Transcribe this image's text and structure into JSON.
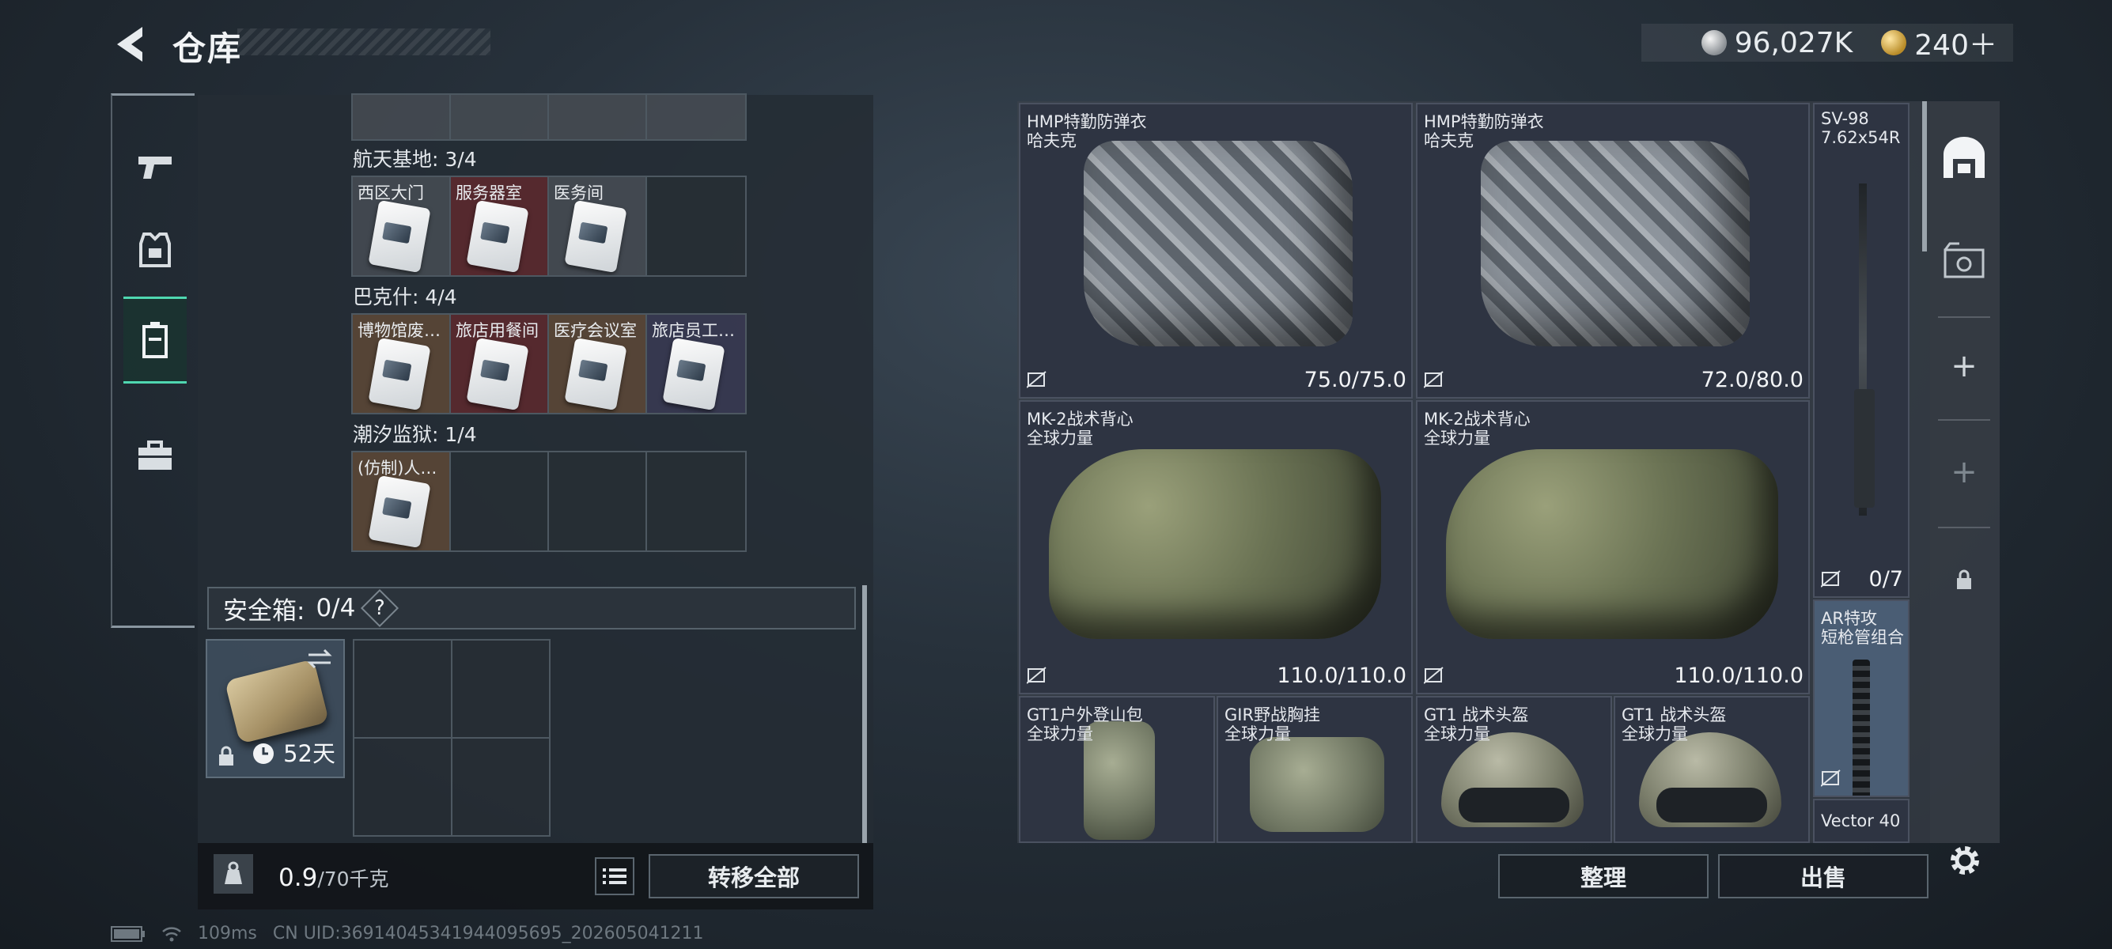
{
  "header": {
    "title": "仓库",
    "back_icon": "back-arrow-icon"
  },
  "currency": {
    "silver_amount": "96,027K",
    "gold_amount": "240＋"
  },
  "left_tabs": [
    {
      "icon": "pistol-icon"
    },
    {
      "icon": "armor-icon"
    },
    {
      "icon": "keycard-case-icon",
      "active": true
    },
    {
      "icon": "briefcase-icon"
    }
  ],
  "key_regions": [
    {
      "label": "航天基地: 3/4",
      "cells": [
        "西区大门",
        "服务器室",
        "医务间",
        ""
      ]
    },
    {
      "label": "巴克什: 4/4",
      "cells": [
        "博物馆废…",
        "旅店用餐间",
        "医疗会议室",
        "旅店员工…"
      ]
    },
    {
      "label": "潮汐监狱: 1/4",
      "cells": [
        "(仿制)人…",
        "",
        "",
        ""
      ]
    }
  ],
  "safe_box": {
    "label": "安全箱:",
    "count": "0/4",
    "help": "?",
    "days": "52天"
  },
  "capacity": {
    "current": "0.9",
    "max": "/70千克",
    "transfer_label": "转移全部"
  },
  "stash_items": [
    {
      "name1": "HMP特勤防弹衣",
      "name2": "哈夫克",
      "durability": "75.0/75.0"
    },
    {
      "name1": "HMP特勤防弹衣",
      "name2": "哈夫克",
      "durability": "72.0/80.0"
    },
    {
      "name1": "SV-98",
      "name2": "7.62x54R",
      "durability": "0/7"
    },
    {
      "name1": "MK-2战术背心",
      "name2": "全球力量",
      "durability": "110.0/110.0"
    },
    {
      "name1": "MK-2战术背心",
      "name2": "全球力量",
      "durability": "110.0/110.0"
    },
    {
      "name1": "AR特攻",
      "name2": "短枪管组合",
      "durability": ""
    },
    {
      "name1": "GT1户外登山包",
      "name2": "全球力量",
      "durability": ""
    },
    {
      "name1": "GIR野战胸挂",
      "name2": "全球力量",
      "durability": ""
    },
    {
      "name1": "GT1 战术头盔",
      "name2": "全球力量",
      "durability": ""
    },
    {
      "name1": "GT1 战术头盔",
      "name2": "全球力量",
      "durability": ""
    },
    {
      "name1": "Vector 40",
      "name2": "",
      "durability": ""
    }
  ],
  "right_rail": {
    "add1": "+",
    "add2": "+"
  },
  "actions": {
    "sort_label": "整理",
    "sell_label": "出售"
  },
  "status": {
    "ping": "109ms",
    "uid": "CN UID:3691404534194409569​5_202605041211"
  },
  "colors": {
    "accent": "#4fd7b0",
    "panel": "#2e3442"
  }
}
